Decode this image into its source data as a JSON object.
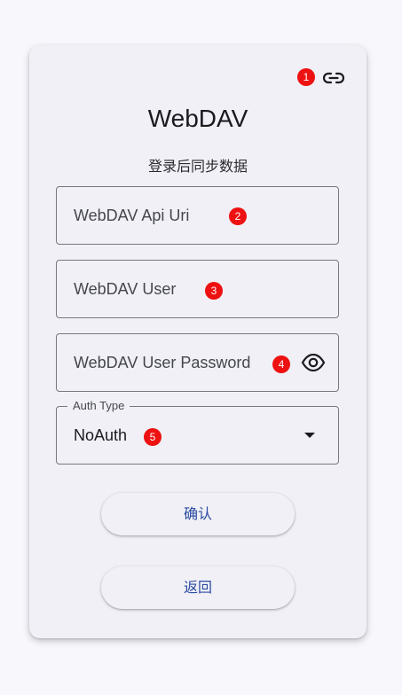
{
  "card": {
    "title": "WebDAV",
    "subtitle": "登录后同步数据"
  },
  "header": {
    "link_icon": "link-icon",
    "link_badge": "1"
  },
  "fields": {
    "api_uri": {
      "placeholder": "WebDAV Api Uri",
      "badge": "2"
    },
    "user": {
      "placeholder": "WebDAV User",
      "badge": "3"
    },
    "password": {
      "placeholder": "WebDAV User Password",
      "badge": "4",
      "icon": "eye-icon"
    },
    "auth_type": {
      "label": "Auth Type",
      "value": "NoAuth",
      "badge": "5",
      "icon": "dropdown-arrow-icon"
    }
  },
  "buttons": {
    "confirm_label": "确认",
    "back_label": "返回"
  },
  "colors": {
    "background": "#f7f7fc",
    "card": "#f0f0f6",
    "badge": "#ee1111",
    "button_text": "#2a4aa0",
    "outline": "#77777f"
  }
}
